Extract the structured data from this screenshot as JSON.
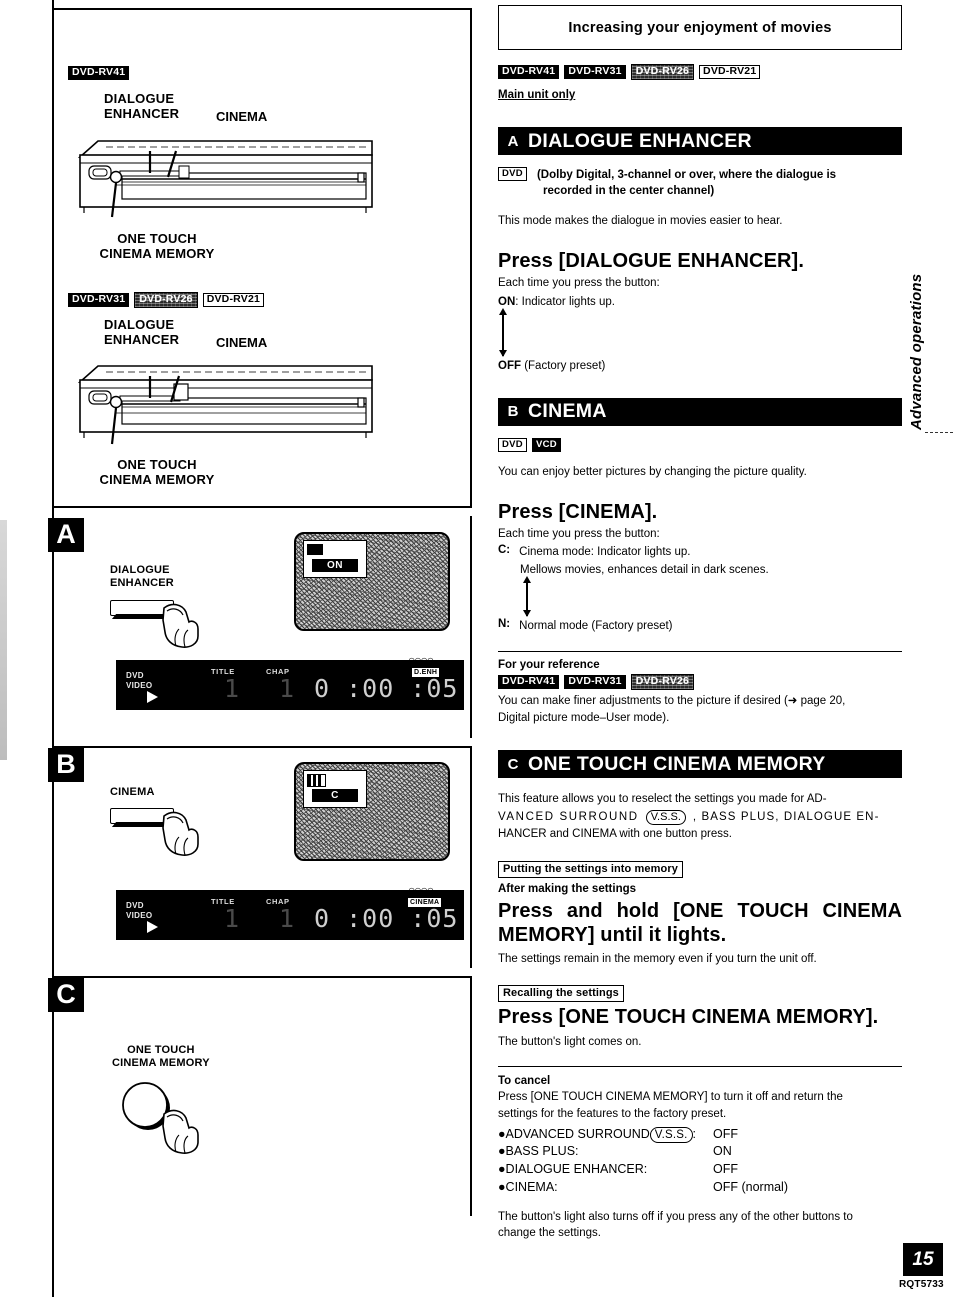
{
  "page": {
    "number": "15",
    "code": "RQT5733",
    "side_tab": "Advanced operations"
  },
  "header": {
    "title": "Increasing your enjoyment of movies",
    "model_badges": [
      "DVD-RV41",
      "DVD-RV31",
      "DVD-RV26",
      "DVD-RV21"
    ],
    "main_unit_only": "Main unit only"
  },
  "left_column": {
    "illustration_1": {
      "model_badges": [
        "DVD-RV41"
      ],
      "label_dialogue": "DIALOGUE",
      "label_enhancer": "ENHANCER",
      "label_cinema": "CINEMA",
      "label_one_touch": "ONE TOUCH",
      "label_cinema_memory": "CINEMA MEMORY"
    },
    "illustration_2": {
      "model_badges": [
        "DVD-RV31",
        "DVD-RV26",
        "DVD-RV21"
      ],
      "label_dialogue": "DIALOGUE",
      "label_enhancer": "ENHANCER",
      "label_cinema": "CINEMA",
      "label_one_touch": "ONE TOUCH",
      "label_cinema_memory": "CINEMA MEMORY"
    },
    "panel_a": {
      "letter": "A",
      "button_label_line1": "DIALOGUE",
      "button_label_line2": "ENHANCER",
      "osd_value": "ON",
      "display": {
        "disc_line1": "DVD",
        "disc_line2": "VIDEO",
        "title_label": "TITLE",
        "chap_label": "CHAP",
        "title_value": "1",
        "chap_value": "1",
        "time": "0 :00 :05",
        "indicator": "D.ENH"
      }
    },
    "panel_b": {
      "letter": "B",
      "button_label_line1": "CINEMA",
      "osd_value": "C",
      "display": {
        "disc_line1": "DVD",
        "disc_line2": "VIDEO",
        "title_label": "TITLE",
        "chap_label": "CHAP",
        "title_value": "1",
        "chap_value": "1",
        "time": "0 :00 :05",
        "indicator": "CINEMA"
      }
    },
    "panel_c": {
      "letter": "C",
      "button_label_line1": "ONE TOUCH",
      "button_label_line2": "CINEMA MEMORY"
    }
  },
  "section_a": {
    "letter": "A",
    "title": "DIALOGUE ENHANCER",
    "disc_badges": [
      "DVD"
    ],
    "condition_line1": "(Dolby Digital, 3-channel or over, where the dialogue is",
    "condition_line2": "recorded in the center channel)",
    "intro": "This mode makes the dialogue in movies easier to hear.",
    "press_heading": "Press [DIALOGUE ENHANCER].",
    "each_time": "Each time you press the button:",
    "state_on_bold": "ON",
    "state_on_rest": ": Indicator lights up.",
    "state_off_bold": "OFF",
    "state_off_rest": " (Factory preset)"
  },
  "section_b": {
    "letter": "B",
    "title": "CINEMA",
    "disc_badges": [
      "DVD",
      "VCD"
    ],
    "intro": "You can enjoy better pictures by changing the picture quality.",
    "press_heading": "Press [CINEMA].",
    "each_time": "Each time you press the button:",
    "state_c_bold": "C:",
    "state_c_rest": "Cinema mode: Indicator lights up.",
    "state_c_detail": "Mellows movies, enhances detail in dark scenes.",
    "state_n_bold": "N:",
    "state_n_rest": "Normal mode (Factory preset)",
    "reference_head": "For your reference",
    "reference_badges": [
      "DVD-RV41",
      "DVD-RV31",
      "DVD-RV26"
    ],
    "reference_line1": "You can make finer adjustments to the picture if desired (➜ page 20,",
    "reference_line2": "Digital picture mode–User mode)."
  },
  "section_c": {
    "letter": "C",
    "title": "ONE TOUCH CINEMA MEMORY",
    "intro_l1_a": "This feature allows you to reselect the settings you made for AD-",
    "intro_l2_a": "VANCED SURROUND",
    "intro_vss": "V.S.S.",
    "intro_l2_b": ", BASS PLUS, DIALOGUE EN-",
    "intro_l3": "HANCER and CINEMA with one button press.",
    "putting_box": "Putting the settings into memory",
    "after_making": "After making the settings",
    "press_hold_heading": "Press and hold [ONE TOUCH CINEMA MEMORY] until it lights.",
    "press_hold_note": "The settings remain in the memory even if you turn the unit off.",
    "recalling_box": "Recalling the settings",
    "recall_heading": "Press [ONE TOUCH CINEMA MEMORY].",
    "recall_note": "The button's light comes on.",
    "cancel_head": "To cancel",
    "cancel_l1": "Press [ONE TOUCH CINEMA MEMORY] to turn it off and return the",
    "cancel_l2": "settings for the features to the factory preset.",
    "cancel_items": [
      {
        "label": "●ADVANCED SURROUND",
        "vss": "V.S.S.",
        "suffix": ":",
        "value": "OFF"
      },
      {
        "label": "●BASS PLUS:",
        "vss": "",
        "suffix": "",
        "value": "ON"
      },
      {
        "label": "●DIALOGUE ENHANCER:",
        "vss": "",
        "suffix": "",
        "value": "OFF"
      },
      {
        "label": "●CINEMA:",
        "vss": "",
        "suffix": "",
        "value": "OFF (normal)"
      }
    ],
    "footer_l1": "The button's light also turns off if you press any of the other buttons to",
    "footer_l2": "change the settings."
  }
}
